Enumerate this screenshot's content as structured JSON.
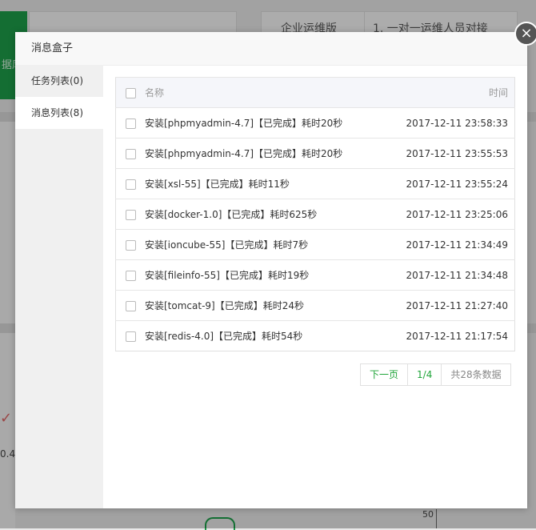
{
  "background": {
    "green_tile_text": "据库",
    "card1_text": "",
    "card2_text": "企业运维版",
    "card3_text": "1. 一对一运维人员对接",
    "left_value": "0.4",
    "axis_tick": "50"
  },
  "modal": {
    "title": "消息盒子",
    "close_glyph": "×",
    "tabs": [
      {
        "label": "任务列表(0)",
        "active": false
      },
      {
        "label": "消息列表(8)",
        "active": true
      }
    ],
    "table": {
      "headers": {
        "name": "名称",
        "time": "时间"
      },
      "rows": [
        {
          "name": "安装[phpmyadmin-4.7]【已完成】耗时20秒",
          "time": "2017-12-11 23:58:33"
        },
        {
          "name": "安装[phpmyadmin-4.7]【已完成】耗时20秒",
          "time": "2017-12-11 23:55:53"
        },
        {
          "name": "安装[xsl-55]【已完成】耗时11秒",
          "time": "2017-12-11 23:55:24"
        },
        {
          "name": "安装[docker-1.0]【已完成】耗时625秒",
          "time": "2017-12-11 23:25:06"
        },
        {
          "name": "安装[ioncube-55]【已完成】耗时7秒",
          "time": "2017-12-11 21:34:49"
        },
        {
          "name": "安装[fileinfo-55]【已完成】耗时19秒",
          "time": "2017-12-11 21:34:48"
        },
        {
          "name": "安装[tomcat-9]【已完成】耗时24秒",
          "time": "2017-12-11 21:27:40"
        },
        {
          "name": "安装[redis-4.0]【已完成】耗时54秒",
          "time": "2017-12-11 21:17:54"
        }
      ]
    },
    "pager": {
      "next": "下一页",
      "page": "1/4",
      "total": "共28条数据"
    }
  },
  "colors": {
    "accent_green": "#20a53a",
    "overlay": "rgba(0,0,0,0.30)"
  }
}
